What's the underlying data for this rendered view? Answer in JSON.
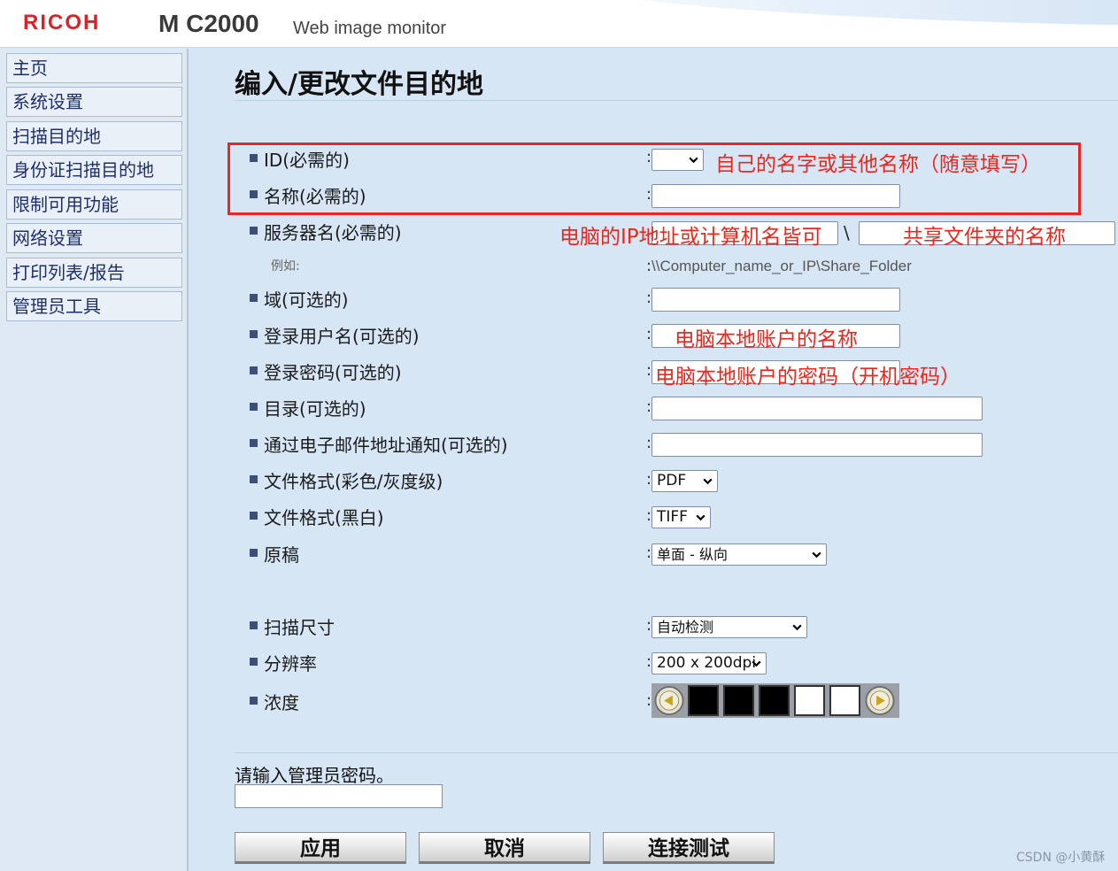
{
  "header": {
    "brand": "RICOH",
    "model": "M C2000",
    "subtitle": "Web image monitor"
  },
  "sidebar": {
    "items": [
      {
        "label": "主页"
      },
      {
        "label": "系统设置"
      },
      {
        "label": "扫描目的地"
      },
      {
        "label": "身份证扫描目的地"
      },
      {
        "label": "限制可用功能"
      },
      {
        "label": "网络设置"
      },
      {
        "label": "打印列表/报告"
      },
      {
        "label": "管理员工具"
      }
    ]
  },
  "page": {
    "title": "编入/更改文件目的地"
  },
  "form": {
    "colon": ":",
    "id_label": "ID(必需的)",
    "name_label": "名称(必需的)",
    "server_label": "服务器名(必需的)",
    "example_label": "例如:",
    "example_value": "\\\\Computer_name_or_IP\\Share_Folder",
    "server_separator": "\\",
    "domain_label": "域(可选的)",
    "login_user_label": "登录用户名(可选的)",
    "login_password_label": "登录密码(可选的)",
    "directory_label": "目录(可选的)",
    "email_notify_label": "通过电子邮件地址通知(可选的)",
    "format_color_label": "文件格式(彩色/灰度级)",
    "format_color_value": "PDF",
    "format_bw_label": "文件格式(黑白)",
    "format_bw_value": "TIFF",
    "original_label": "原稿",
    "original_value": "单面 - 纵向",
    "scan_size_label": "扫描尺寸",
    "scan_size_value": "自动检测",
    "resolution_label": "分辨率",
    "resolution_value": "200 x 200dpi",
    "density_label": "浓度",
    "density_level": 3,
    "density_max": 5
  },
  "annotations": {
    "id_name_note": "自己的名字或其他名称（随意填写）",
    "server_note": "电脑的IP地址或计算机名皆可",
    "share_note": "共享文件夹的名称",
    "user_note": "电脑本地账户的名称",
    "password_note": "电脑本地账户的密码（开机密码）",
    "highlight_color": "#e8281f"
  },
  "footer": {
    "admin_password_prompt": "请输入管理员密码。",
    "apply_label": "应用",
    "cancel_label": "取消",
    "connection_test_label": "连接测试",
    "watermark": "CSDN @小黄酥"
  },
  "colors": {
    "brand": "#d8232a",
    "background": "#d7e6f5",
    "nav_text": "#1f2f6a",
    "bullet": "#3d4f78"
  }
}
